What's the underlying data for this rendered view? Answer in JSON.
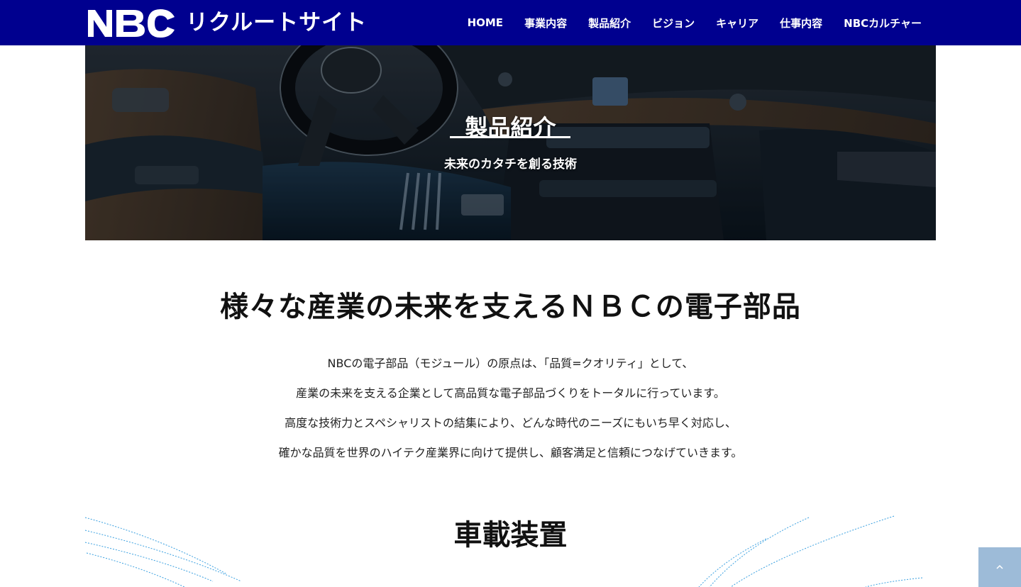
{
  "header": {
    "logo_mark": "NBC",
    "site_title": "リクルートサイト",
    "bg_color": "#00008f"
  },
  "nav": {
    "items": [
      "HOME",
      "事業内容",
      "製品紹介",
      "ビジョン",
      "キャリア",
      "仕事内容",
      "NBCカルチャー"
    ]
  },
  "hero": {
    "title": "製品紹介",
    "subtitle": "未来のカタチを創る技術"
  },
  "main": {
    "heading": "様々な産業の未来を支えるＮＢＣの電子部品",
    "intro_lines": [
      "NBCの電子部品（モジュール）の原点は、「品質=クオリティ」として、",
      "産業の未来を支える企業として高品質な電子部品づくりをトータルに行っています。",
      "高度な技術力とスペシャリストの結集により、どんな時代のニーズにもいち早く対応し、",
      "確かな品質を世界のハイテク産業界に向けて提供し、顧客満足と信頼につなげていきます。"
    ]
  },
  "section": {
    "heading": "車載装置"
  },
  "scroll_top": {
    "icon": "chevron-up-icon",
    "bg_color": "#9dbbd8"
  }
}
